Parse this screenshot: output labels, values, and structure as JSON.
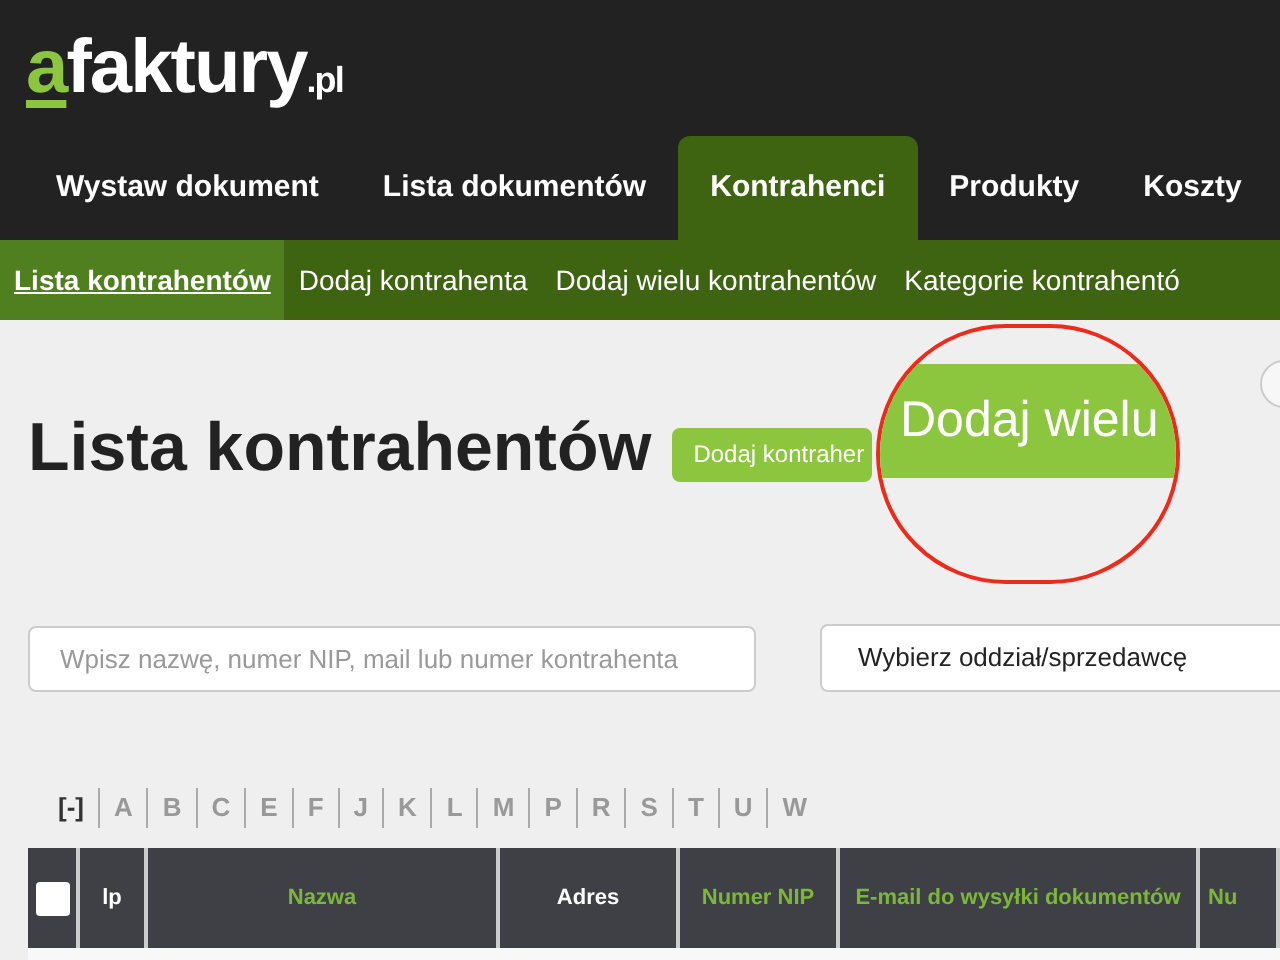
{
  "logo": {
    "accent": "a",
    "text": "faktury",
    "suffix": ".pl"
  },
  "main_nav": [
    {
      "label": "Wystaw dokument",
      "selected": false
    },
    {
      "label": "Lista dokumentów",
      "selected": false
    },
    {
      "label": "Kontrahenci",
      "selected": true
    },
    {
      "label": "Produkty",
      "selected": false
    },
    {
      "label": "Koszty",
      "selected": false
    }
  ],
  "sub_nav": [
    {
      "label": "Lista kontrahentów",
      "selected": true
    },
    {
      "label": "Dodaj kontrahenta",
      "selected": false
    },
    {
      "label": "Dodaj wielu kontrahentów",
      "selected": false
    },
    {
      "label": "Kategorie kontrahentó",
      "selected": false
    }
  ],
  "page_title": "Lista kontrahentów",
  "add_button": "Dodaj kontraher",
  "magnifier": {
    "button": "Dodaj wielu"
  },
  "search": {
    "placeholder": "Wpisz nazwę, numer NIP, mail lub numer kontrahenta"
  },
  "branch_select": {
    "value": "Wybierz oddział/sprzedawcę"
  },
  "letters": [
    {
      "label": "[-]",
      "selected": true
    },
    {
      "label": "A",
      "selected": false
    },
    {
      "label": "B",
      "selected": false
    },
    {
      "label": "C",
      "selected": false
    },
    {
      "label": "E",
      "selected": false
    },
    {
      "label": "F",
      "selected": false
    },
    {
      "label": "J",
      "selected": false
    },
    {
      "label": "K",
      "selected": false
    },
    {
      "label": "L",
      "selected": false
    },
    {
      "label": "M",
      "selected": false
    },
    {
      "label": "P",
      "selected": false
    },
    {
      "label": "R",
      "selected": false
    },
    {
      "label": "S",
      "selected": false
    },
    {
      "label": "T",
      "selected": false
    },
    {
      "label": "U",
      "selected": false
    },
    {
      "label": "W",
      "selected": false
    }
  ],
  "table": {
    "select_all": {
      "checked": false
    },
    "columns": [
      {
        "label": "lp",
        "sortable": false
      },
      {
        "label": "Nazwa",
        "sortable": true
      },
      {
        "label": "Adres",
        "sortable": false
      },
      {
        "label": "Numer NIP",
        "sortable": true
      },
      {
        "label": "E-mail do wysyłki dokumentów",
        "sortable": true
      },
      {
        "label": "Nu",
        "sortable": true
      }
    ]
  }
}
